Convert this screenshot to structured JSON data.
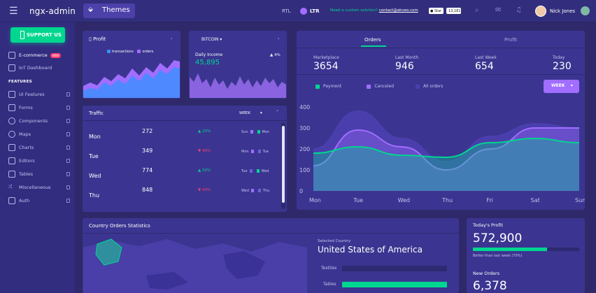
{
  "header": {
    "brand": "ngx-admin",
    "themes_label": "Themes",
    "rtl": "RTL",
    "ltr": "LTR",
    "custom_text": "Need a custom solution?",
    "custom_link": "contact@akveo.com",
    "star_label": "Star",
    "star_count": "13,181",
    "user_name": "Nick Jones"
  },
  "sidebar": {
    "support_label": "SUPPORT US",
    "features_label": "FEATURES",
    "new_badge": "NEW",
    "items": [
      {
        "label": "E-commerce"
      },
      {
        "label": "IoT Dashboard"
      },
      {
        "label": "UI Features"
      },
      {
        "label": "Forms"
      },
      {
        "label": "Components"
      },
      {
        "label": "Maps"
      },
      {
        "label": "Charts"
      },
      {
        "label": "Editors"
      },
      {
        "label": "Tables"
      },
      {
        "label": "Miscellaneous"
      },
      {
        "label": "Auth"
      }
    ]
  },
  "profit_card": {
    "title": "Profit",
    "legend_transactions": "transactions",
    "legend_orders": "orders"
  },
  "bitcoin_card": {
    "title": "BITCOIN",
    "daily_income_label": "Daily Income",
    "daily_income_value": "45,895",
    "change": "4%"
  },
  "traffic_card": {
    "title": "Traffic",
    "period": "WEEK",
    "rows": [
      {
        "day": "Mon",
        "value": "272",
        "pct": "20%",
        "dir": "up",
        "cmp_a": "Sun",
        "cmp_b": "Mon"
      },
      {
        "day": "Tue",
        "value": "349",
        "pct": "40%",
        "dir": "down",
        "cmp_a": "Mon",
        "cmp_b": "Tue"
      },
      {
        "day": "Wed",
        "value": "774",
        "pct": "50%",
        "dir": "up",
        "cmp_a": "Tue",
        "cmp_b": "Wed"
      },
      {
        "day": "Thu",
        "value": "848",
        "pct": "43%",
        "dir": "down",
        "cmp_a": "Wed",
        "cmp_b": "Thu"
      }
    ]
  },
  "orders_card": {
    "tab_orders": "Orders",
    "tab_profit": "Profit",
    "stats": [
      {
        "label": "Marketplace",
        "value": "3654"
      },
      {
        "label": "Last Month",
        "value": "946"
      },
      {
        "label": "Last Week",
        "value": "654"
      },
      {
        "label": "Today",
        "value": "230"
      }
    ],
    "legend_payment": "Payment",
    "legend_canceled": "Canceled",
    "legend_all": "All orders",
    "period_button": "WEEK"
  },
  "country_card": {
    "title": "Country Orders Statistics",
    "selected_label": "Selected Country",
    "selected_value": "United States of America",
    "bar_textiles": "Textiles",
    "bar_tables": "Tables"
  },
  "today_profit": {
    "title": "Today's Profit",
    "value": "572,900",
    "note": "Better than last week (70%)",
    "progress": 0.7,
    "new_orders_title": "New Orders",
    "new_orders_value": "6,378"
  },
  "chart_data": {
    "type": "area",
    "categories": [
      "Mon",
      "Tue",
      "Wed",
      "Thu",
      "Fri",
      "Sat",
      "Sun"
    ],
    "ylim": [
      0,
      400
    ],
    "yticks": [
      0,
      100,
      200,
      300,
      400
    ],
    "series": [
      {
        "name": "Payment",
        "color": "#00d68f",
        "values": [
          180,
          210,
          170,
          160,
          230,
          250,
          230
        ]
      },
      {
        "name": "Canceled",
        "color": "#a16eff",
        "values": [
          120,
          290,
          210,
          100,
          200,
          300,
          300
        ]
      },
      {
        "name": "All orders",
        "color": "#4c3fb0",
        "values": [
          200,
          380,
          250,
          140,
          260,
          320,
          300
        ]
      }
    ]
  },
  "colors": {
    "accent": "#00d68f",
    "primary": "#a16eff",
    "danger": "#ff3d71",
    "card": "#3b3591",
    "bg": "#2f296b"
  }
}
